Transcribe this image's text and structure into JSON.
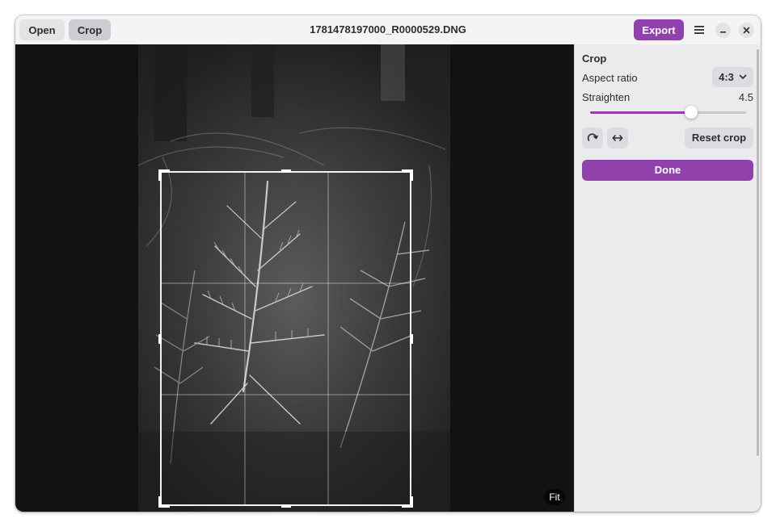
{
  "header": {
    "open_label": "Open",
    "crop_label": "Crop",
    "title": "1781478197000_R0000529.DNG",
    "export_label": "Export",
    "menu_icon": "hamburger-menu-icon",
    "minimize_icon": "minimize-icon",
    "close_icon": "close-icon"
  },
  "canvas": {
    "fit_label": "Fit",
    "image_description_icon": "photo"
  },
  "crop_panel": {
    "heading": "Crop",
    "aspect_ratio_label": "Aspect ratio",
    "aspect_ratio_value": "4:3",
    "straighten_label": "Straighten",
    "straighten_value": "4.5",
    "straighten_fraction": 0.65,
    "rotate_icon": "rotate-icon",
    "flip_icon": "flip-horizontal-icon",
    "reset_label": "Reset crop",
    "done_label": "Done"
  },
  "colors": {
    "accent": "#9141ac",
    "canvas_bg": "#121214"
  }
}
